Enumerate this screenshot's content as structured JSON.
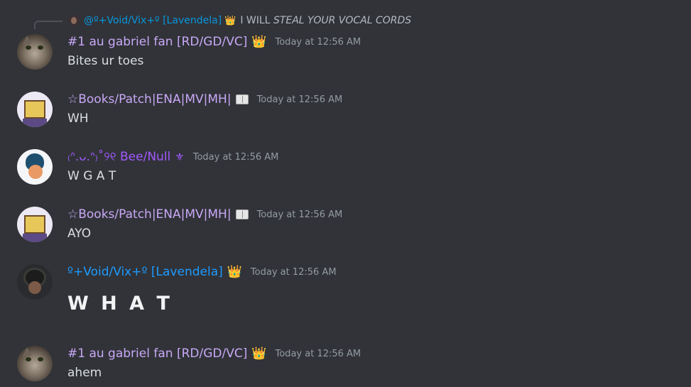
{
  "reply": {
    "author": "@º+Void/Vix+º [Lavendela]",
    "author_icon": "crown-icon",
    "crown": "👑",
    "text_plain": "I WILL",
    "text_italic": "STEAL YOUR VOCAL CORDS"
  },
  "messages": [
    {
      "author": "#1 au gabriel fan [RD/GD/VC]",
      "author_color": "#c9a8f7",
      "tag": "👑",
      "timestamp": "Today at 12:56 AM",
      "content": "Bites ur toes"
    },
    {
      "author": "☆Books/Patch|ENA|MV|MH|",
      "author_color": "#c9a8f7",
      "tag": "book-icon",
      "timestamp": "Today at 12:56 AM",
      "content": "WH"
    },
    {
      "author": "₍ᐢ.ᴗ.ᐢ₎˚୨୧ Bee/Null",
      "author_color": "#a259ff",
      "tag": "⚜",
      "timestamp": "Today at 12:56 AM",
      "content": "W G A T"
    },
    {
      "author": "☆Books/Patch|ENA|MV|MH|",
      "author_color": "#c9a8f7",
      "tag": "book-icon",
      "timestamp": "Today at 12:56 AM",
      "content": "AYO"
    },
    {
      "author": "º+Void/Vix+º [Lavendela]",
      "author_color": "#1e9bff",
      "tag": "👑",
      "timestamp": "Today at 12:56 AM",
      "content": "W H A T"
    },
    {
      "author": "#1 au gabriel fan [RD/GD/VC]",
      "author_color": "#c9a8f7",
      "tag": "👑",
      "timestamp": "Today at 12:56 AM",
      "content": "ahem"
    }
  ]
}
